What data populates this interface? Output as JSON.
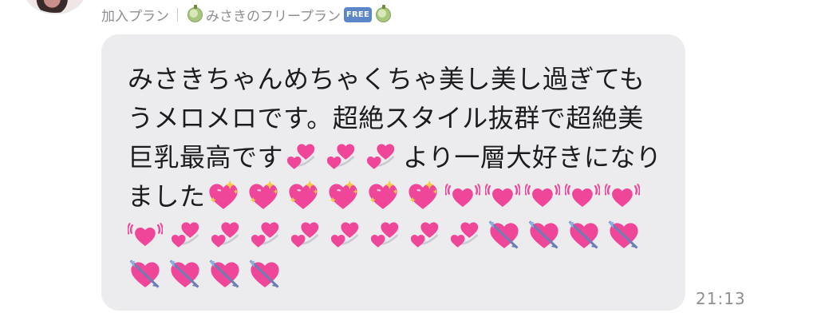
{
  "plan_header": {
    "label": "加入プラン",
    "plan_name": "みさきのフリープラン",
    "badge": "FREE"
  },
  "message": {
    "text_lines": [
      "みさきちゃんめちゃくちゃ美し美し過ぎても",
      "うメロメロです。超絶スタイル抜群で超絶美",
      "巨乳最高です",
      "より一層大好きになり",
      "ました"
    ],
    "emoji_groups": {
      "inline_revolving": [
        "revolving-hearts",
        "revolving-hearts",
        "revolving-hearts"
      ],
      "sparkling": [
        "sparkling-heart",
        "sparkling-heart",
        "sparkling-heart",
        "sparkling-heart",
        "sparkling-heart",
        "sparkling-heart"
      ],
      "beating": [
        "beating-heart",
        "beating-heart",
        "beating-heart",
        "beating-heart",
        "beating-heart",
        "beating-heart"
      ],
      "revolving": [
        "revolving-hearts",
        "revolving-hearts",
        "revolving-hearts",
        "revolving-hearts",
        "revolving-hearts",
        "revolving-hearts",
        "revolving-hearts",
        "revolving-hearts"
      ],
      "arrow": [
        "heart-with-arrow",
        "heart-with-arrow",
        "heart-with-arrow",
        "heart-with-arrow",
        "heart-with-arrow",
        "heart-with-arrow",
        "heart-with-arrow",
        "heart-with-arrow"
      ]
    },
    "timestamp": "21:13"
  },
  "colors": {
    "bubble": "#ececee",
    "text": "#1c1c1e",
    "meta": "#8e8e93",
    "heart": "#f0469a",
    "badge": "#5b87c9",
    "melon": "#a7c77f"
  }
}
